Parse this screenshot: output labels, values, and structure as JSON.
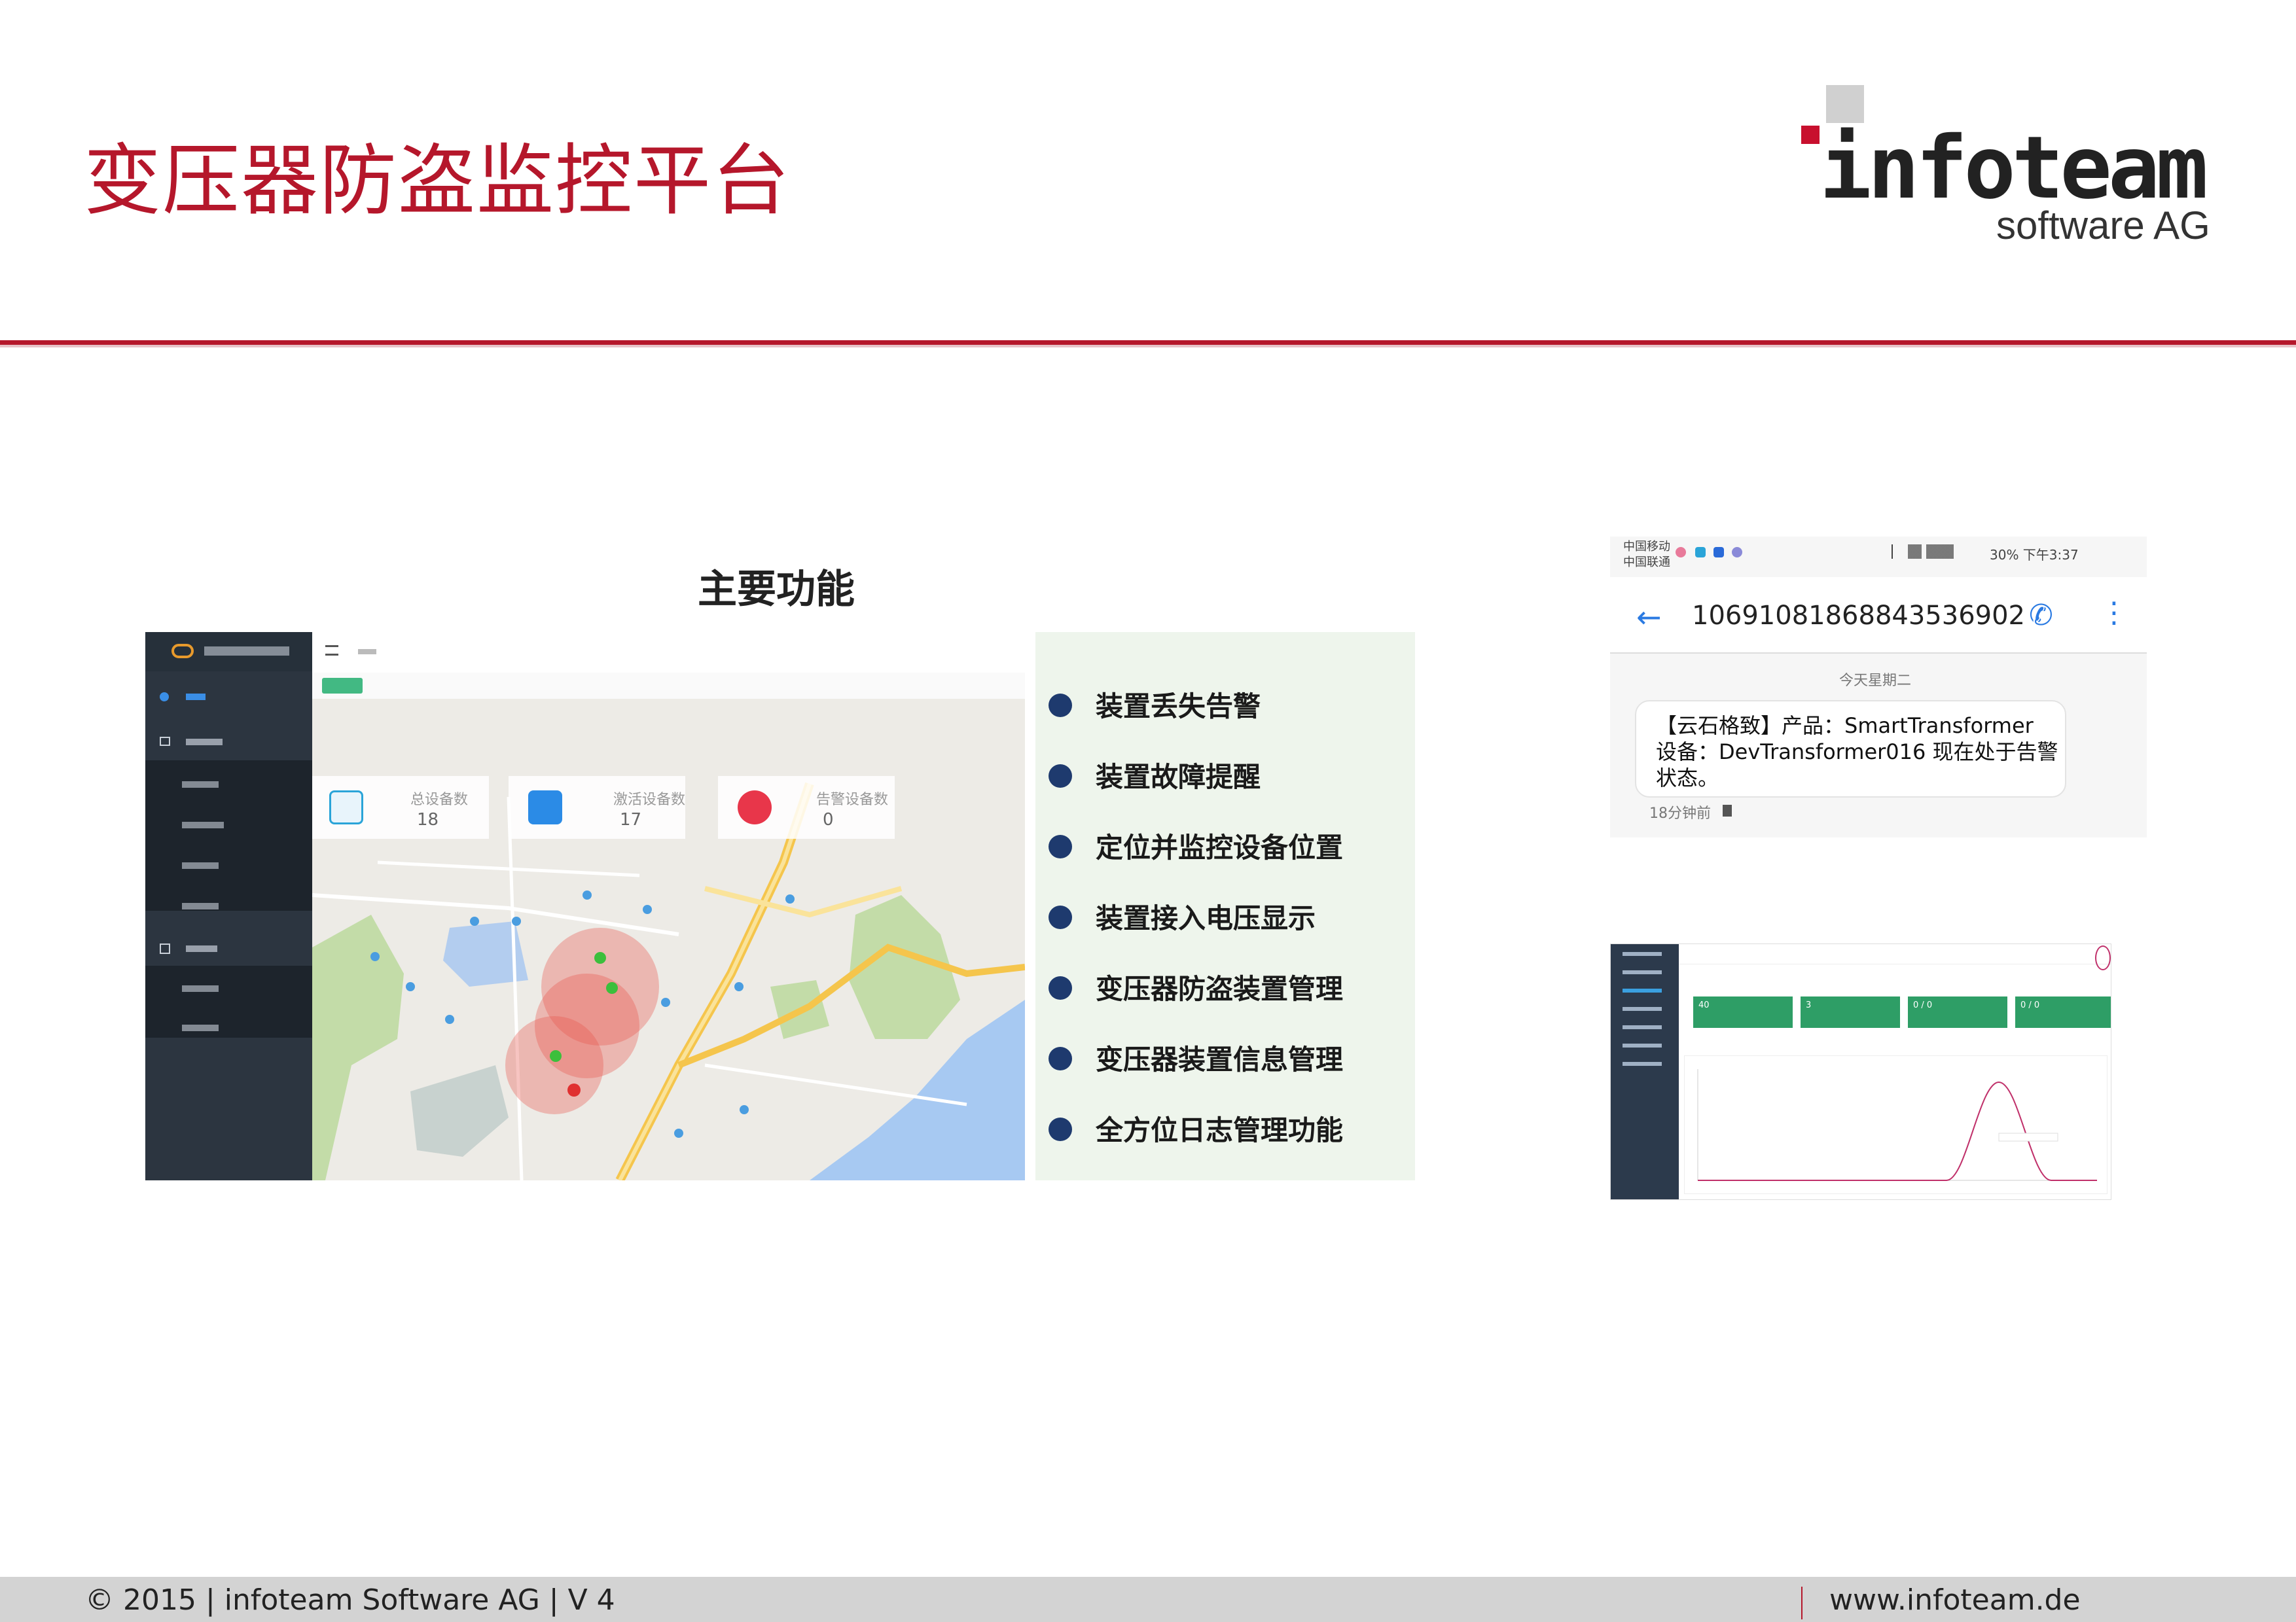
{
  "slide": {
    "title": "变压器防盗监控平台",
    "logo": {
      "brand": "infoteam",
      "sub": "software AG"
    },
    "footer": {
      "left": "© 2015 | infoteam Software AG | V 4",
      "right": "www.infoteam.de"
    },
    "accent_color": "#b5172b"
  },
  "features": {
    "title": "主要功能",
    "items": [
      "装置丢失告警",
      "装置故障提醒",
      "定位并监控设备位置",
      "装置接入电压显示",
      "变压器防盗装置管理",
      "变压器装置信息管理",
      "全方位日志管理功能"
    ],
    "bullet_color": "#1e3a6e"
  },
  "dashboard": {
    "stats": [
      {
        "label": "总设备数",
        "value": "18",
        "icon": "monitor-icon"
      },
      {
        "label": "激活设备数",
        "value": "17",
        "icon": "chat-icon"
      },
      {
        "label": "告警设备数",
        "value": "0",
        "icon": "info-icon"
      }
    ]
  },
  "phone": {
    "status_left": [
      "中国移动",
      "中国联通"
    ],
    "status_right": "30%  下午3:37",
    "sender": "1069108186884353​6902",
    "day": "今天星期二",
    "message": [
      "【云石格致】产品：SmartTransformer",
      "设备：DevTransformer016 现在处于告警",
      "状态。"
    ],
    "time": "18分钟前"
  },
  "mini_dashboard": {
    "cards": [
      "40",
      "3",
      "0 / 0",
      "0 / 0"
    ],
    "peak_color": "#c0306a"
  }
}
